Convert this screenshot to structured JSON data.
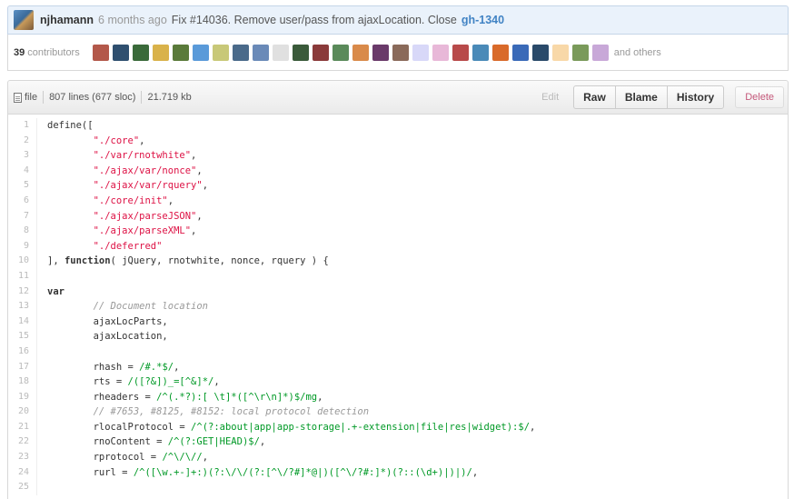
{
  "commit": {
    "author": "njhamann",
    "time": "6 months ago",
    "message": "Fix #14036. Remove user/pass from ajaxLocation. Close",
    "link": "gh-1340"
  },
  "contributors": {
    "count": "39",
    "label": "contributors",
    "others": "and others",
    "avatar_colors": [
      "#b3584a",
      "#2f4f6f",
      "#3a6a3a",
      "#d9b24a",
      "#5a7a3a",
      "#5a9ad9",
      "#c8c878",
      "#4a6a8a",
      "#6a8ab8",
      "#e0e0e0",
      "#3a5a3a",
      "#8a3a3a",
      "#5a8a5a",
      "#d98a4a",
      "#6a3a6a",
      "#8a6a5a",
      "#d8d8f8",
      "#e8b8d8",
      "#b84a4a",
      "#4a8ab8",
      "#d96a2a",
      "#3a6ab8",
      "#2a4a6a",
      "#f8d8a8",
      "#7a9a5a",
      "#c8a8d8"
    ]
  },
  "file": {
    "label": "file",
    "lines": "807 lines (677 sloc)",
    "size": "21.719 kb",
    "edit": "Edit",
    "raw": "Raw",
    "blame": "Blame",
    "history": "History",
    "delete": "Delete"
  },
  "code": [
    {
      "n": "1",
      "t": [
        [
          "",
          "define(["
        ]
      ]
    },
    {
      "n": "2",
      "t": [
        [
          "",
          "\t"
        ],
        [
          "str",
          "\"./core\""
        ],
        [
          "",
          ","
        ]
      ]
    },
    {
      "n": "3",
      "t": [
        [
          "",
          "\t"
        ],
        [
          "str",
          "\"./var/rnotwhite\""
        ],
        [
          "",
          ","
        ]
      ]
    },
    {
      "n": "4",
      "t": [
        [
          "",
          "\t"
        ],
        [
          "str",
          "\"./ajax/var/nonce\""
        ],
        [
          "",
          ","
        ]
      ]
    },
    {
      "n": "5",
      "t": [
        [
          "",
          "\t"
        ],
        [
          "str",
          "\"./ajax/var/rquery\""
        ],
        [
          "",
          ","
        ]
      ]
    },
    {
      "n": "6",
      "t": [
        [
          "",
          "\t"
        ],
        [
          "str",
          "\"./core/init\""
        ],
        [
          "",
          ","
        ]
      ]
    },
    {
      "n": "7",
      "t": [
        [
          "",
          "\t"
        ],
        [
          "str",
          "\"./ajax/parseJSON\""
        ],
        [
          "",
          ","
        ]
      ]
    },
    {
      "n": "8",
      "t": [
        [
          "",
          "\t"
        ],
        [
          "str",
          "\"./ajax/parseXML\""
        ],
        [
          "",
          ","
        ]
      ]
    },
    {
      "n": "9",
      "t": [
        [
          "",
          "\t"
        ],
        [
          "str",
          "\"./deferred\""
        ]
      ]
    },
    {
      "n": "10",
      "t": [
        [
          "",
          "], "
        ],
        [
          "kw",
          "function"
        ],
        [
          "",
          "( jQuery, rnotwhite, nonce, rquery ) {"
        ]
      ]
    },
    {
      "n": "11",
      "t": [
        [
          "",
          ""
        ]
      ]
    },
    {
      "n": "12",
      "t": [
        [
          "kw",
          "var"
        ]
      ]
    },
    {
      "n": "13",
      "t": [
        [
          "",
          "\t"
        ],
        [
          "cm",
          "// Document location"
        ]
      ]
    },
    {
      "n": "14",
      "t": [
        [
          "",
          "\tajaxLocParts,"
        ]
      ]
    },
    {
      "n": "15",
      "t": [
        [
          "",
          "\tajaxLocation,"
        ]
      ]
    },
    {
      "n": "16",
      "t": [
        [
          "",
          ""
        ]
      ]
    },
    {
      "n": "17",
      "t": [
        [
          "",
          "\trhash = "
        ],
        [
          "rx",
          "/#.*$/"
        ],
        [
          "",
          ","
        ]
      ]
    },
    {
      "n": "18",
      "t": [
        [
          "",
          "\trts = "
        ],
        [
          "rx",
          "/([?&])_=[^&]*/"
        ],
        [
          "",
          ","
        ]
      ]
    },
    {
      "n": "19",
      "t": [
        [
          "",
          "\trheaders = "
        ],
        [
          "rx",
          "/^(.*?):[ \\t]*([^\\r\\n]*)$/mg"
        ],
        [
          "",
          ","
        ]
      ]
    },
    {
      "n": "20",
      "t": [
        [
          "",
          "\t"
        ],
        [
          "cm",
          "// #7653, #8125, #8152: local protocol detection"
        ]
      ]
    },
    {
      "n": "21",
      "t": [
        [
          "",
          "\trlocalProtocol = "
        ],
        [
          "rx",
          "/^(?:about|app|app-storage|.+-extension|file|res|widget):$/"
        ],
        [
          "",
          ","
        ]
      ]
    },
    {
      "n": "22",
      "t": [
        [
          "",
          "\trnoContent = "
        ],
        [
          "rx",
          "/^(?:GET|HEAD)$/"
        ],
        [
          "",
          ","
        ]
      ]
    },
    {
      "n": "23",
      "t": [
        [
          "",
          "\trprotocol = "
        ],
        [
          "rx",
          "/^\\/\\//"
        ],
        [
          "",
          ","
        ]
      ]
    },
    {
      "n": "24",
      "t": [
        [
          "",
          "\trurl = "
        ],
        [
          "rx",
          "/^([\\w.+-]+:)(?:\\/\\/(?:[^\\/?#]*@|)([^\\/?#:]*)(?::(\\d+)|)|)/"
        ],
        [
          "",
          ","
        ]
      ]
    },
    {
      "n": "25",
      "t": [
        [
          "",
          ""
        ]
      ]
    }
  ]
}
